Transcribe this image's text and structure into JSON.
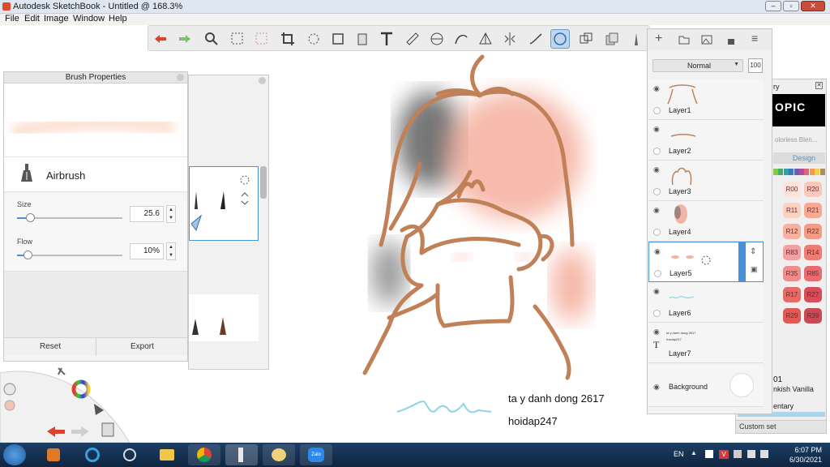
{
  "window": {
    "title": "Autodesk SketchBook - Untitled @ 168.3%"
  },
  "menu": [
    "File",
    "Edit",
    "Image",
    "Window",
    "Help"
  ],
  "toolbar": {
    "tools": [
      "undo-icon",
      "redo-icon",
      "zoom-icon",
      "select-icon",
      "transform-icon",
      "crop-icon",
      "lasso-icon",
      "distort-icon",
      "fill-icon",
      "text-icon",
      "ruler-icon",
      "ellipse-guide-icon",
      "curve-guide-icon",
      "perspective-icon",
      "symmetry-icon",
      "stroke-icon",
      "predictive-stroke-icon",
      "copy-icon",
      "layers-icon",
      "brush-icon"
    ]
  },
  "brush_properties": {
    "title": "Brush Properties",
    "brush_name": "Airbrush",
    "size_label": "Size",
    "size_value": "25.6",
    "size_level": 0.12,
    "flow_label": "Flow",
    "flow_value": "10%",
    "flow_level": 0.1,
    "reset_label": "Reset",
    "export_label": "Export"
  },
  "layers": {
    "blend_mode": "Normal",
    "opacity": "100",
    "items": [
      {
        "name": "Layer1"
      },
      {
        "name": "Layer2"
      },
      {
        "name": "Layer3"
      },
      {
        "name": "Layer4"
      },
      {
        "name": "Layer5"
      },
      {
        "name": "Layer6"
      },
      {
        "name": "Layer7",
        "thumb_line1": "ta y danh dong 2617",
        "thumb_line2": "hoidap247"
      }
    ],
    "background_label": "Background"
  },
  "copic": {
    "title_fragment": "ry",
    "logo_fragment": "OPIC",
    "search_hint": "olorless Blen...",
    "tabs": [
      "",
      "Design"
    ],
    "swatches": [
      "R00",
      "R20",
      "R11",
      "R21",
      "R12",
      "R22",
      "R83",
      "R14",
      "R35",
      "R85",
      "R17",
      "R27",
      "R29",
      "R39"
    ],
    "selected_code": "01",
    "selected_name": "nkish Vanilla",
    "category": "entary",
    "custom_set_label": "Custom set"
  },
  "canvas": {
    "text_line1": "ta y danh dong 2617",
    "text_line2": "hoidap247"
  },
  "taskbar": {
    "language": "EN",
    "time": "6:07 PM",
    "date": "6/30/2021"
  },
  "colors": {
    "accent": "#4a90d9",
    "stroke": "#c08058",
    "blush": "#f4a190",
    "signature": "#8fd3e6"
  }
}
